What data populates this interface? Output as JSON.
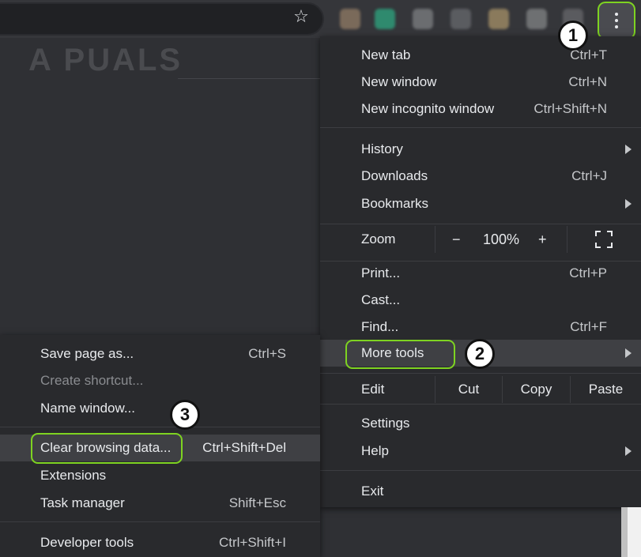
{
  "watermark": "A PUALS",
  "toolbar": {
    "star_icon": "star-icon",
    "menu_icon": "three-dots-vertical-icon",
    "extension_colors": [
      "#7a6a5a",
      "#2f8a6e",
      "#6b6d70",
      "#5a5c60",
      "#8a7a5c",
      "#6e7072",
      "#5a5b5f"
    ]
  },
  "callouts": {
    "one": "1",
    "two": "2",
    "three": "3"
  },
  "main_menu": {
    "new_tab": {
      "label": "New tab",
      "shortcut": "Ctrl+T"
    },
    "new_window": {
      "label": "New window",
      "shortcut": "Ctrl+N"
    },
    "new_incognito": {
      "label": "New incognito window",
      "shortcut": "Ctrl+Shift+N"
    },
    "history": {
      "label": "History"
    },
    "downloads": {
      "label": "Downloads",
      "shortcut": "Ctrl+J"
    },
    "bookmarks": {
      "label": "Bookmarks"
    },
    "zoom": {
      "label": "Zoom",
      "minus": "−",
      "value": "100%",
      "plus": "+"
    },
    "print": {
      "label": "Print...",
      "shortcut": "Ctrl+P"
    },
    "cast": {
      "label": "Cast..."
    },
    "find": {
      "label": "Find...",
      "shortcut": "Ctrl+F"
    },
    "more_tools": {
      "label": "More tools"
    },
    "edit": {
      "label": "Edit",
      "cut": "Cut",
      "copy": "Copy",
      "paste": "Paste"
    },
    "settings": {
      "label": "Settings"
    },
    "help": {
      "label": "Help"
    },
    "exit": {
      "label": "Exit"
    }
  },
  "sub_menu": {
    "save_page": {
      "label": "Save page as...",
      "shortcut": "Ctrl+S"
    },
    "create_shortcut": {
      "label": "Create shortcut..."
    },
    "name_window": {
      "label": "Name window..."
    },
    "clear_browsing": {
      "label": "Clear browsing data...",
      "shortcut": "Ctrl+Shift+Del"
    },
    "extensions": {
      "label": "Extensions"
    },
    "task_manager": {
      "label": "Task manager",
      "shortcut": "Shift+Esc"
    },
    "developer_tools": {
      "label": "Developer tools",
      "shortcut": "Ctrl+Shift+I"
    }
  },
  "colors": {
    "highlight_outline": "#7ed321",
    "menu_bg": "#292a2d"
  }
}
